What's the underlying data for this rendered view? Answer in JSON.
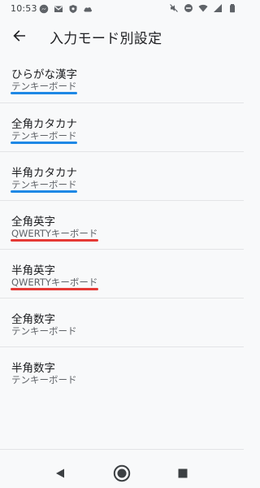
{
  "status_bar": {
    "time": "10:53",
    "left_icons": [
      "messenger-icon",
      "gmail-icon",
      "shield-icon",
      "cloud-icon"
    ],
    "right_icons": [
      "mute-icon",
      "do-not-disturb-icon",
      "wifi-icon",
      "signal-icon",
      "battery-icon"
    ]
  },
  "app_bar": {
    "title": "入力モード別設定"
  },
  "items": [
    {
      "title": "ひらがな漢字",
      "subtitle": "テンキーボード",
      "highlight": "#1e88e5",
      "highlight_fraction": 0.272
    },
    {
      "title": "全角カタカナ",
      "subtitle": "テンキーボード",
      "highlight": "#1e88e5",
      "highlight_fraction": 0.272
    },
    {
      "title": "半角カタカナ",
      "subtitle": "テンキーボード",
      "highlight": "#1e88e5",
      "highlight_fraction": 0.272
    },
    {
      "title": "全角英字",
      "subtitle": "QWERTYキーボード",
      "highlight": "#e53935",
      "highlight_fraction": 0.36
    },
    {
      "title": "半角英字",
      "subtitle": "QWERTYキーボード",
      "highlight": "#e53935",
      "highlight_fraction": 0.36
    },
    {
      "title": "全角数字",
      "subtitle": "テンキーボード",
      "highlight": "",
      "highlight_fraction": 0
    },
    {
      "title": "半角数字",
      "subtitle": "テンキーボード",
      "highlight": "",
      "highlight_fraction": 0
    }
  ],
  "colors": {
    "background": "#f8f9fa",
    "text_primary": "#202124",
    "text_secondary": "#5f6368",
    "divider": "#e3e4e6",
    "blue_underline": "#1e88e5",
    "red_underline": "#e53935",
    "nav_icon": "#3c4043"
  },
  "nav_bar": {
    "buttons": [
      "back-triangle-icon",
      "home-circle-icon",
      "recents-square-icon"
    ]
  }
}
